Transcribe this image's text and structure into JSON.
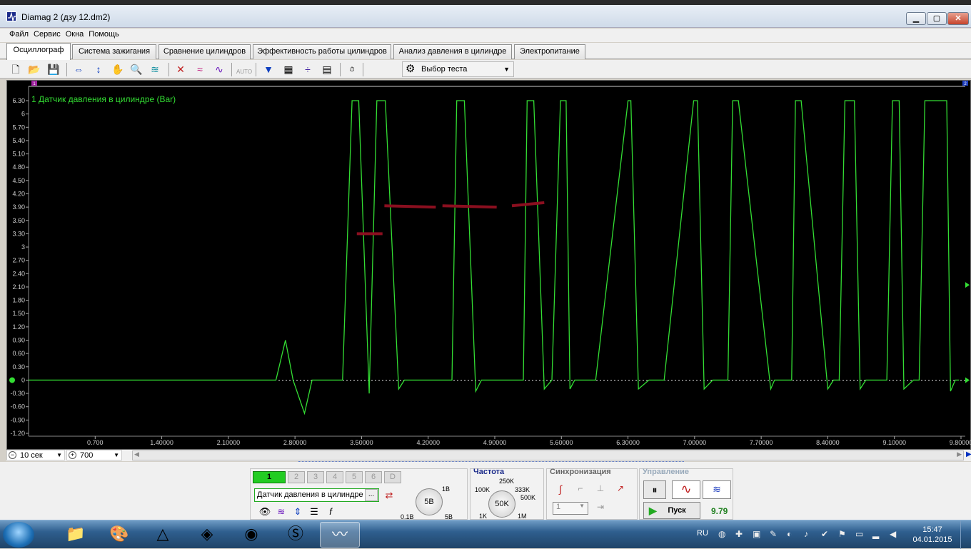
{
  "window": {
    "title": "Diamag 2 (дзу 12.dm2)"
  },
  "menu": [
    "Файл",
    "Сервис",
    "Окна",
    "Помощь"
  ],
  "tabs": [
    "Осциллограф",
    "Система зажигания",
    "Сравнение цилиндров",
    "Эффективность работы цилиндров",
    "Анализ давления в цилиндре",
    "Электропитание"
  ],
  "toolbar": {
    "test_select": "Выбор теста",
    "auto_label": "AUTO"
  },
  "scope": {
    "channel_label": "1 Датчик давления в цилиндре (Bar)",
    "marker_left": "1",
    "marker_right": "2",
    "trace_color": "#33dd33",
    "marker_color": "#8a0f1f",
    "y_ticks": [
      "6.30",
      "6",
      "5.70",
      "5.40",
      "5.10",
      "4.80",
      "4.50",
      "4.20",
      "3.90",
      "3.60",
      "3.30",
      "3",
      "2.70",
      "2.40",
      "2.10",
      "1.80",
      "1.50",
      "1.20",
      "0.90",
      "0.60",
      "0.30",
      "0",
      "-0.30",
      "-0.60",
      "-0.90",
      "-1.20"
    ],
    "x_ticks": [
      "0.700",
      "1.40000",
      "2.10000",
      "2.80000",
      "3.50000",
      "4.20000",
      "4.90000",
      "5.60000",
      "6.30000",
      "7.00000",
      "7.70000",
      "8.40000",
      "9.10000",
      "9.80000"
    ]
  },
  "chart_data": {
    "type": "line",
    "xlabel": "",
    "ylabel": "",
    "ylim": [
      -1.2,
      6.3
    ],
    "xlim": [
      0,
      9.8
    ],
    "series": [
      {
        "name": "1 Датчик давления в цилиндре (Bar)",
        "x": [
          0.0,
          2.6,
          2.7,
          2.78,
          2.9,
          2.98,
          3.0,
          3.1,
          3.3,
          3.4,
          3.47,
          3.58,
          3.66,
          3.75,
          3.89,
          3.95,
          4.04,
          4.1,
          4.45,
          4.5,
          4.58,
          4.7,
          4.76,
          4.86,
          5.2,
          5.24,
          5.31,
          5.42,
          5.5,
          5.59,
          5.65,
          5.69,
          5.74,
          5.83,
          5.9,
          5.96,
          6.3,
          6.33,
          6.41,
          6.52,
          6.6,
          6.68,
          6.99,
          7.03,
          7.1,
          7.19,
          7.35,
          7.4,
          7.46,
          7.8,
          7.84,
          7.91,
          8.02,
          8.06,
          8.12,
          8.4,
          8.46,
          8.52,
          8.58,
          8.68,
          8.74,
          8.8,
          9.02,
          9.08,
          9.15,
          9.2,
          9.3,
          9.36,
          9.42,
          9.65,
          9.69,
          9.74,
          9.78
        ],
        "values": [
          0,
          0,
          0.9,
          0,
          -0.75,
          0,
          0,
          0,
          0,
          6.3,
          6.3,
          -0.3,
          6.3,
          6.3,
          -0.2,
          0,
          0,
          0,
          0,
          6.3,
          6.3,
          -0.25,
          0,
          0,
          0,
          6.3,
          6.3,
          -0.2,
          0,
          6.3,
          6.3,
          -0.2,
          0,
          0,
          0,
          0,
          6.3,
          6.3,
          -0.2,
          0,
          0,
          0,
          6.3,
          6.3,
          -0.2,
          0,
          0,
          6.3,
          6.3,
          -0.2,
          0,
          0,
          0,
          6.3,
          6.3,
          -0.2,
          0,
          0,
          6.3,
          6.3,
          -0.2,
          0,
          0,
          6.3,
          6.3,
          -0.2,
          0,
          0,
          6.3,
          6.3,
          -0.25,
          0,
          0
        ]
      }
    ]
  },
  "scope_controls": {
    "timebase": "10 сек",
    "points": "700"
  },
  "channels": {
    "buttons": [
      "1",
      "2",
      "3",
      "4",
      "5",
      "6",
      "D"
    ],
    "sensor": "Датчик давления в цилиндре",
    "sensor_btn": "...",
    "knob_value": "5В",
    "knob_labels": [
      "1В",
      "0.1В",
      "5В"
    ]
  },
  "frequency": {
    "title": "Частота",
    "knob_value": "50K",
    "labels": [
      "250K",
      "100K",
      "333K",
      "500K",
      "1K",
      "1M"
    ]
  },
  "sync": {
    "title": "Синхронизация",
    "channel": "1"
  },
  "control": {
    "title": "Управление",
    "start_label": "Пуск",
    "value": "9.79"
  },
  "taskbar": {
    "lang": "RU",
    "time": "15:47",
    "date": "04.01.2015"
  }
}
